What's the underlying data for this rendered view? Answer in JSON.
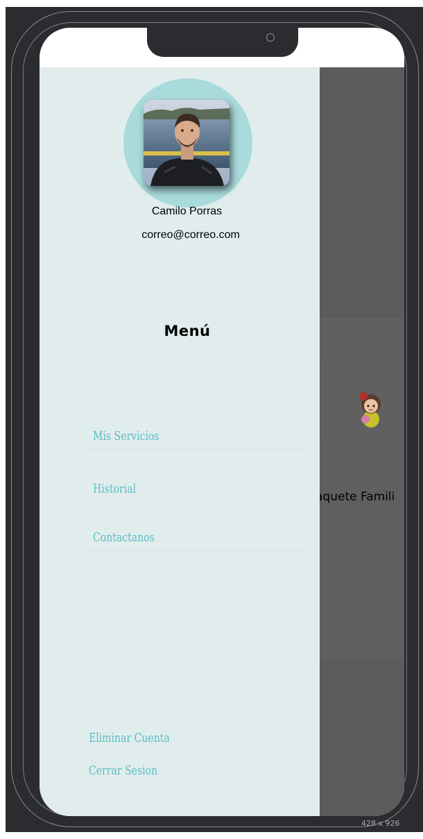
{
  "drawer": {
    "user_name": "Camilo Porras",
    "user_email": "correo@correo.com",
    "menu_title": "Menú",
    "menu_items": [
      {
        "label": "Mis Servicios"
      },
      {
        "label": "Historial"
      },
      {
        "label": "Contactanos"
      }
    ],
    "delete_account_label": "Eliminar Cuenta",
    "logout_label": "Cerrar Sesion"
  },
  "background_page": {
    "card_title": "aquete Famili"
  },
  "device": {
    "size_label": "428 x 926"
  },
  "colors": {
    "drawer_bg": "#e1eded",
    "accent": "#5bbcc4",
    "avatar_ring": "#a9dadc",
    "overlay": "#5c5c5c",
    "frame": "#2b2c2f"
  }
}
